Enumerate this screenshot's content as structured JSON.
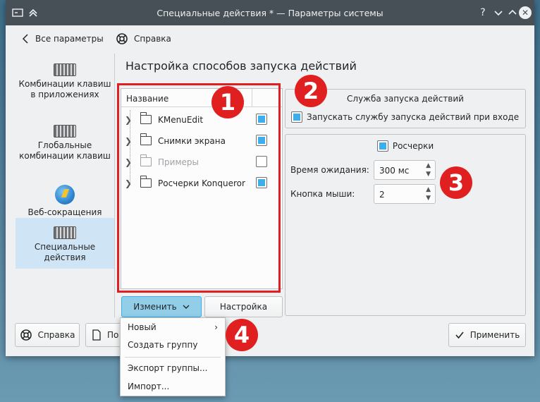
{
  "window": {
    "title": "Специальные действия * — Параметры системы"
  },
  "nav": {
    "back_label": "Все параметры",
    "help_label": "Справка"
  },
  "sidebar": {
    "items": [
      {
        "label": "Комбинации клавиш в приложениях",
        "icon": "keyboard-icon"
      },
      {
        "label": "Глобальные комбинации клавиш",
        "icon": "keyboard-icon"
      },
      {
        "label": "Веб-сокращения",
        "icon": "globe-icon"
      },
      {
        "label": "Специальные действия",
        "icon": "keyboard-icon",
        "selected": true
      }
    ]
  },
  "main": {
    "heading": "Настройка способов запуска действий",
    "tree": {
      "header": "Название",
      "rows": [
        {
          "label": "KMenuEdit",
          "checked": true,
          "enabled": true
        },
        {
          "label": "Снимки экрана",
          "checked": true,
          "enabled": true
        },
        {
          "label": "Примеры",
          "checked": false,
          "enabled": false
        },
        {
          "label": "Росчерки Konqueror",
          "checked": true,
          "enabled": true
        }
      ]
    },
    "daemon": {
      "title": "Служба запуска действий",
      "autostart_label": "Запускать службу запуска действий при входе"
    },
    "gestures": {
      "title": "Росчерки",
      "timeout_label": "Время ожидания:",
      "timeout_value": "300 мс",
      "button_label": "Кнопка мыши:",
      "button_value": "2"
    },
    "edit_button": "Изменить",
    "settings_button": "Настройка"
  },
  "menu": {
    "items": [
      "Новый",
      "Создать группу",
      "Экспорт группы...",
      "Импорт..."
    ]
  },
  "footer": {
    "help_button": "Справка",
    "defaults_button_partial": "По",
    "apply_button": "Применить"
  },
  "annotations": [
    "1",
    "2",
    "3",
    "4"
  ],
  "colors": {
    "accent": "#3daee9",
    "titlebar": "#475057",
    "annotation": "#e02020",
    "selection": "#cfe4f5"
  }
}
